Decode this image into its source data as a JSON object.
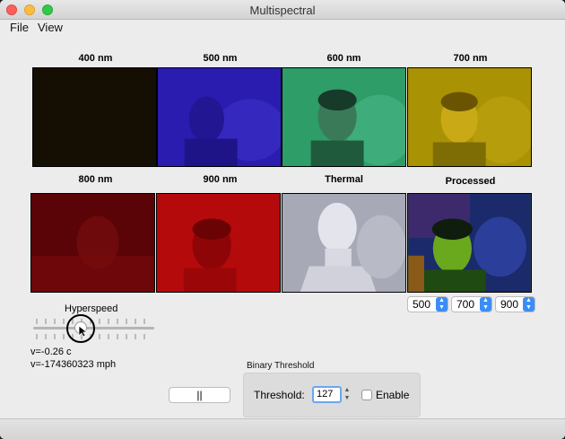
{
  "window": {
    "title": "Multispectral"
  },
  "menu": {
    "file": "File",
    "view": "View"
  },
  "panels": [
    {
      "label": "400 nm",
      "color": "#150e02"
    },
    {
      "label": "500 nm",
      "color": "#2a1bb5"
    },
    {
      "label": "600 nm",
      "color": "#2e9d68"
    },
    {
      "label": "700 nm",
      "color": "#a99203"
    },
    {
      "label": "800 nm",
      "color": "#5a0407"
    },
    {
      "label": "900 nm",
      "color": "#b50a0c"
    },
    {
      "label": "Thermal",
      "color": "#a7a9b6"
    },
    {
      "label": "Processed",
      "color": "#3a6a18"
    }
  ],
  "channels": {
    "r": "500",
    "g": "700",
    "b": "900"
  },
  "slider": {
    "label": "Hyperspeed",
    "value": -0.26
  },
  "readout": {
    "v_c": "v=-0.26 c",
    "v_mph": "v=-174360323 mph"
  },
  "pause_button": {
    "label": "||"
  },
  "binary_threshold": {
    "title": "Binary Threshold",
    "threshold_label": "Threshold:",
    "threshold_value": "127",
    "enable_label": "Enable",
    "enabled": false
  }
}
